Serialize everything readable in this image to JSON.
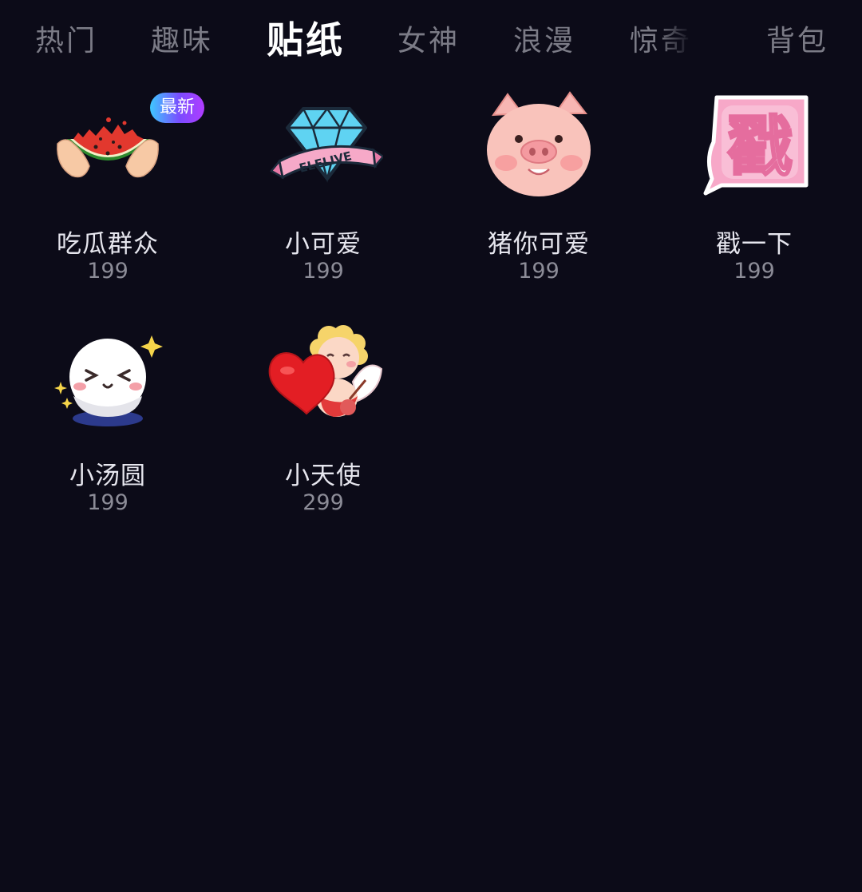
{
  "tabs": [
    {
      "label": "热门"
    },
    {
      "label": "趣味"
    },
    {
      "label": "贴纸"
    },
    {
      "label": "女神"
    },
    {
      "label": "浪漫"
    },
    {
      "label": "惊奇"
    },
    {
      "label": "背包"
    }
  ],
  "active_tab": "贴纸",
  "stickers": [
    {
      "name": "吃瓜群众",
      "price": "199",
      "badge": "最新",
      "icon": "watermelon-icon"
    },
    {
      "name": "小可爱",
      "price": "199",
      "icon": "diamond-icon",
      "banner_text": "ELELIVE"
    },
    {
      "name": "猪你可爱",
      "price": "199",
      "icon": "pig-icon"
    },
    {
      "name": "戳一下",
      "price": "199",
      "icon": "poke-icon",
      "art_text": "戳"
    },
    {
      "name": "小汤圆",
      "price": "199",
      "icon": "dumpling-icon"
    },
    {
      "name": "小天使",
      "price": "299",
      "icon": "cupid-icon"
    }
  ],
  "colors": {
    "background": "#0c0b18",
    "tab_inactive": "#7b7b86",
    "tab_active": "#ffffff",
    "name_text": "#e6e6ee",
    "price_text": "#8c8c97",
    "badge_gradient": [
      "#3ec8ff",
      "#7b4bff",
      "#b13cff"
    ]
  }
}
